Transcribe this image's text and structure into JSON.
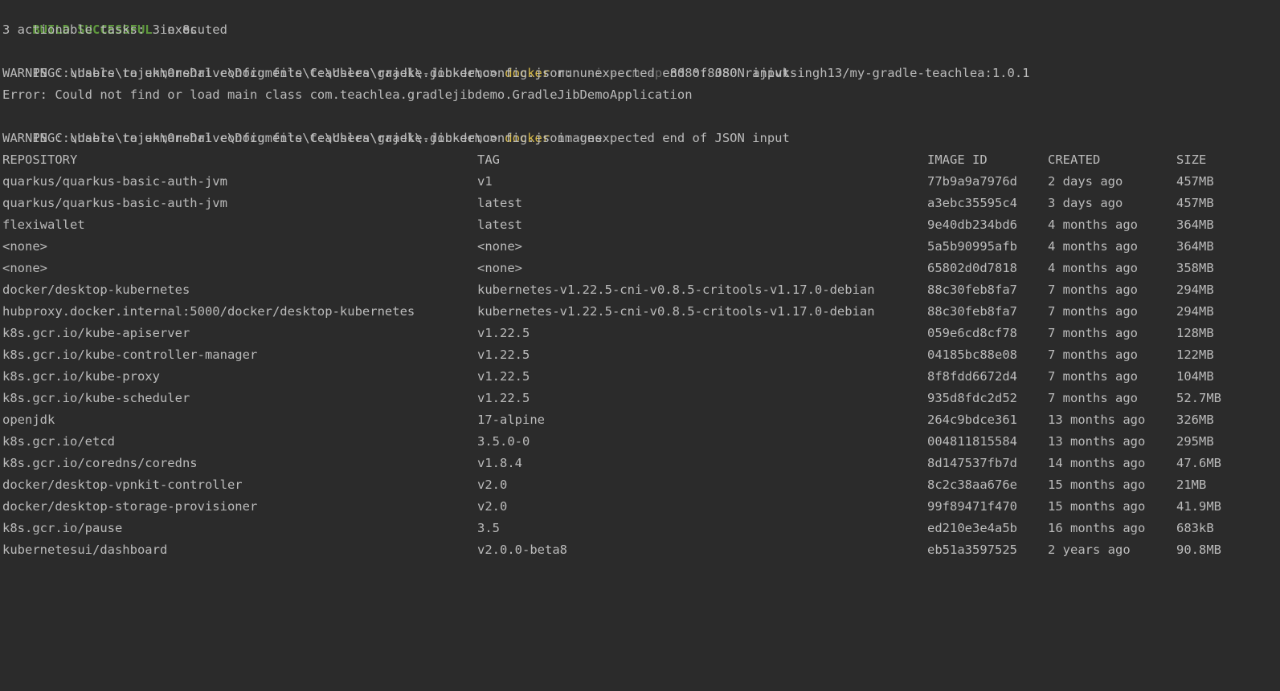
{
  "output": {
    "build_status": "BUILD SUCCESSFUL",
    "build_time": " in 8s",
    "tasks_line": "3 actionable tasks: 3 executed"
  },
  "prompt": {
    "path": "PS C:\\Users\\rajek\\OneDrive\\Documents\\teachlea\\gradle-jib-demo> "
  },
  "command_run": {
    "exe": "docker",
    "sub": " run ",
    "flags": "-i --rm -p",
    "args": " 8080:8080 rajivksingh13/my-gradle-teachlea:1.0.1"
  },
  "warning_line": "WARNING: unable to unmarshal config file C:\\Users\\rajek\\.docker\\config.json: unexpected end of JSON input",
  "error_line": "Error: Could not find or load main class com.teachlea.gradlejibdemo.GradleJibDemoApplication",
  "command_images": {
    "exe": "docker",
    "sub": " images"
  },
  "table": {
    "headers": {
      "repository": "REPOSITORY",
      "tag": "TAG",
      "image_id": "IMAGE ID",
      "created": "CREATED",
      "size": "SIZE"
    },
    "rows": [
      {
        "repository": "quarkus/quarkus-basic-auth-jvm",
        "tag": "v1",
        "image_id": "77b9a9a7976d",
        "created": "2 days ago",
        "size": "457MB"
      },
      {
        "repository": "quarkus/quarkus-basic-auth-jvm",
        "tag": "latest",
        "image_id": "a3ebc35595c4",
        "created": "3 days ago",
        "size": "457MB"
      },
      {
        "repository": "flexiwallet",
        "tag": "latest",
        "image_id": "9e40db234bd6",
        "created": "4 months ago",
        "size": "364MB"
      },
      {
        "repository": "<none>",
        "tag": "<none>",
        "image_id": "5a5b90995afb",
        "created": "4 months ago",
        "size": "364MB"
      },
      {
        "repository": "<none>",
        "tag": "<none>",
        "image_id": "65802d0d7818",
        "created": "4 months ago",
        "size": "358MB"
      },
      {
        "repository": "docker/desktop-kubernetes",
        "tag": "kubernetes-v1.22.5-cni-v0.8.5-critools-v1.17.0-debian",
        "image_id": "88c30feb8fa7",
        "created": "7 months ago",
        "size": "294MB"
      },
      {
        "repository": "hubproxy.docker.internal:5000/docker/desktop-kubernetes",
        "tag": "kubernetes-v1.22.5-cni-v0.8.5-critools-v1.17.0-debian",
        "image_id": "88c30feb8fa7",
        "created": "7 months ago",
        "size": "294MB"
      },
      {
        "repository": "k8s.gcr.io/kube-apiserver",
        "tag": "v1.22.5",
        "image_id": "059e6cd8cf78",
        "created": "7 months ago",
        "size": "128MB"
      },
      {
        "repository": "k8s.gcr.io/kube-controller-manager",
        "tag": "v1.22.5",
        "image_id": "04185bc88e08",
        "created": "7 months ago",
        "size": "122MB"
      },
      {
        "repository": "k8s.gcr.io/kube-proxy",
        "tag": "v1.22.5",
        "image_id": "8f8fdd6672d4",
        "created": "7 months ago",
        "size": "104MB"
      },
      {
        "repository": "k8s.gcr.io/kube-scheduler",
        "tag": "v1.22.5",
        "image_id": "935d8fdc2d52",
        "created": "7 months ago",
        "size": "52.7MB"
      },
      {
        "repository": "openjdk",
        "tag": "17-alpine",
        "image_id": "264c9bdce361",
        "created": "13 months ago",
        "size": "326MB"
      },
      {
        "repository": "k8s.gcr.io/etcd",
        "tag": "3.5.0-0",
        "image_id": "004811815584",
        "created": "13 months ago",
        "size": "295MB"
      },
      {
        "repository": "k8s.gcr.io/coredns/coredns",
        "tag": "v1.8.4",
        "image_id": "8d147537fb7d",
        "created": "14 months ago",
        "size": "47.6MB"
      },
      {
        "repository": "docker/desktop-vpnkit-controller",
        "tag": "v2.0",
        "image_id": "8c2c38aa676e",
        "created": "15 months ago",
        "size": "21MB"
      },
      {
        "repository": "docker/desktop-storage-provisioner",
        "tag": "v2.0",
        "image_id": "99f89471f470",
        "created": "15 months ago",
        "size": "41.9MB"
      },
      {
        "repository": "k8s.gcr.io/pause",
        "tag": "3.5",
        "image_id": "ed210e3e4a5b",
        "created": "16 months ago",
        "size": "683kB"
      },
      {
        "repository": "kubernetesui/dashboard",
        "tag": "v2.0.0-beta8",
        "image_id": "eb51a3597525",
        "created": "2 years ago",
        "size": "90.8MB"
      }
    ]
  }
}
